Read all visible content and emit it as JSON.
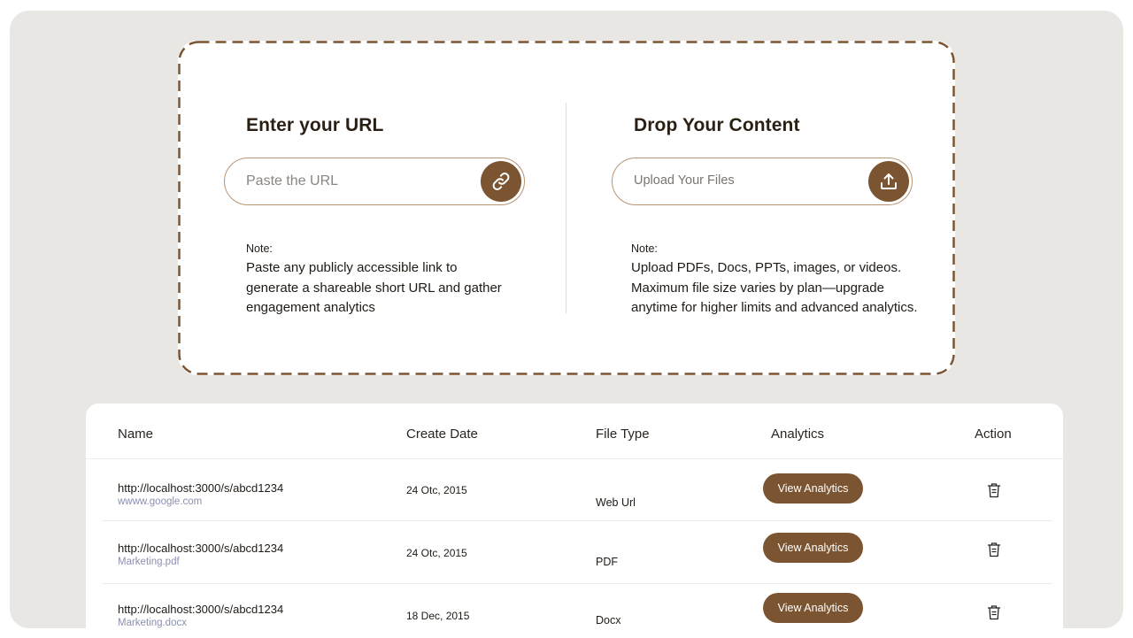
{
  "url_panel": {
    "title": "Enter your URL",
    "placeholder": "Paste the URL",
    "button_icon": "link-icon",
    "note_label": "Note:",
    "note_lines": [
      "Paste any publicly accessible link to",
      "generate a shareable short URL and gather",
      "engagement analytics"
    ]
  },
  "upload_panel": {
    "title": "Drop Your Content",
    "placeholder": "Upload Your Files",
    "button_icon": "upload-icon",
    "note_label": "Note:",
    "note_lines": [
      "Upload PDFs, Docs, PPTs, images, or videos.",
      "Maximum file size varies by plan—upgrade",
      "anytime for higher limits and advanced analytics."
    ]
  },
  "table": {
    "headers": {
      "name": "Name",
      "create_date": "Create Date",
      "file_type": "File Type",
      "analytics": "Analytics",
      "action": "Action"
    },
    "rows": [
      {
        "link": "http://localhost:3000/s/abcd1234",
        "source": "wwww.google.com",
        "date": "24 Otc, 2015",
        "type": "Web Url",
        "analytics_label": "View Analytics",
        "action_icon": "trash-icon"
      },
      {
        "link": "http://localhost:3000/s/abcd1234",
        "source": "Marketing.pdf",
        "date": "24 Otc, 2015",
        "type": "PDF",
        "analytics_label": "View Analytics",
        "action_icon": "trash-icon"
      },
      {
        "link": "http://localhost:3000/s/abcd1234",
        "source": "Marketing.docx",
        "date": "18 Dec, 2015",
        "type": "Docx",
        "analytics_label": "View Analytics",
        "action_icon": "trash-icon"
      }
    ]
  },
  "colors": {
    "accent": "#7b5431",
    "dash_border": "#7b5431",
    "background": "#e9e7e3",
    "subtext": "#8b8fb0"
  }
}
